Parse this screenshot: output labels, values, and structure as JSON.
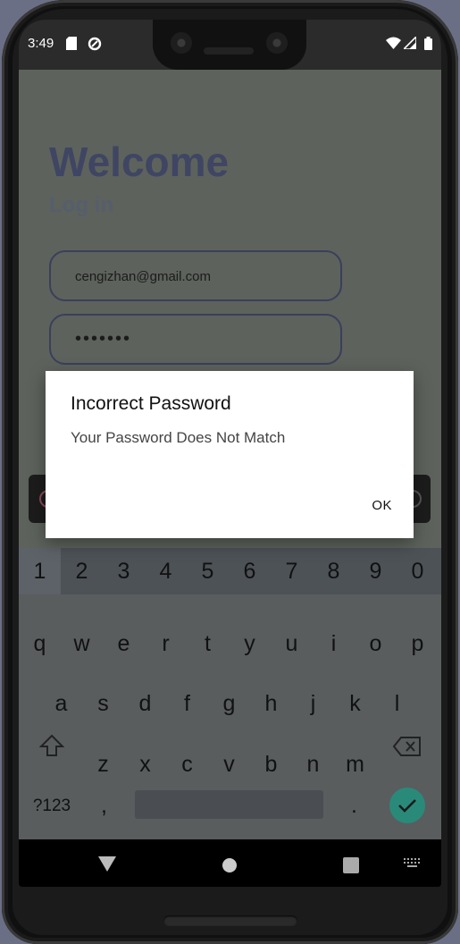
{
  "status_bar": {
    "time": "3:49",
    "icons": [
      "sd-card-icon",
      "data-saver-icon",
      "wifi-icon",
      "signal-icon",
      "battery-icon"
    ]
  },
  "login": {
    "welcome": "Welcome",
    "subtitle": "Log in",
    "email_value": "cengizhan@gmail.com",
    "password_value": "•••••••"
  },
  "dialog": {
    "title": "Incorrect Password",
    "message": "Your Password Does Not Match",
    "ok_label": "OK"
  },
  "keyboard": {
    "numbers": [
      "1",
      "2",
      "3",
      "4",
      "5",
      "6",
      "7",
      "8",
      "9",
      "0"
    ],
    "row1": [
      "q",
      "w",
      "e",
      "r",
      "t",
      "y",
      "u",
      "i",
      "o",
      "p"
    ],
    "row2": [
      "a",
      "s",
      "d",
      "f",
      "g",
      "h",
      "j",
      "k",
      "l"
    ],
    "row3": [
      "z",
      "x",
      "c",
      "v",
      "b",
      "n",
      "m"
    ],
    "symbols_label": "?123",
    "comma": ",",
    "period": "."
  },
  "colors": {
    "accent": "#2a8a7a",
    "dialog_bg": "#ffffff",
    "overlay_app": "#5d625c"
  }
}
